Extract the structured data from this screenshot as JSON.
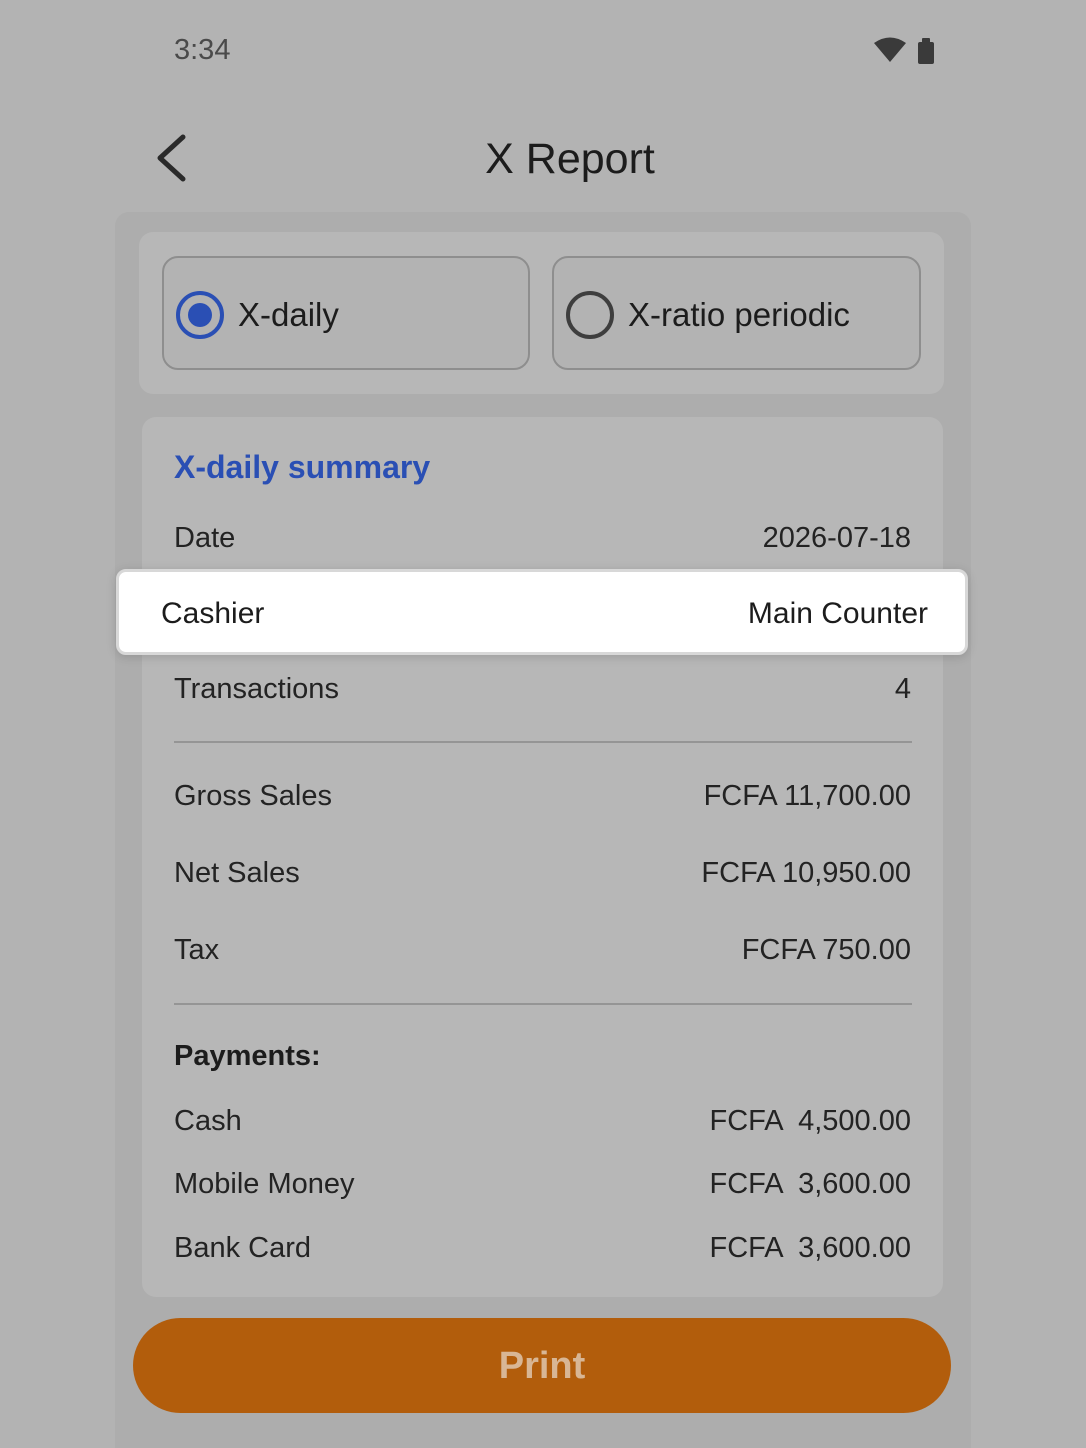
{
  "status_bar": {
    "time": "3:34",
    "icons": [
      "wifi-icon",
      "battery-icon"
    ]
  },
  "header": {
    "title": "X Report",
    "back_icon": "chevron-left-icon"
  },
  "report_modes": {
    "options": [
      {
        "label": "X-daily",
        "selected": true
      },
      {
        "label": "X-ratio periodic",
        "selected": false
      }
    ]
  },
  "summary": {
    "title": "X-daily summary",
    "date_label": "Date",
    "date_value": "2026-07-18",
    "cashier_label": "Cashier",
    "cashier_value": "Main Counter",
    "transactions_label": "Transactions",
    "transactions_value": "4",
    "gross_sales_label": "Gross Sales",
    "gross_sales_value": "FCFA 11,700.00",
    "net_sales_label": "Net Sales",
    "net_sales_value": "FCFA 10,950.00",
    "tax_label": "Tax",
    "tax_value": "FCFA 750.00",
    "payments_heading": "Payments:",
    "payments": [
      {
        "label": "Cash",
        "value": "FCFA  4,500.00"
      },
      {
        "label": "Mobile Money",
        "value": "FCFA  3,600.00"
      },
      {
        "label": "Bank Card",
        "value": "FCFA  3,600.00"
      }
    ]
  },
  "actions": {
    "print_label": "Print"
  },
  "colors": {
    "accent_blue": "#2a4fb4",
    "print_orange": "#b25d0c",
    "overlay_gray": "#b3b3b3"
  }
}
